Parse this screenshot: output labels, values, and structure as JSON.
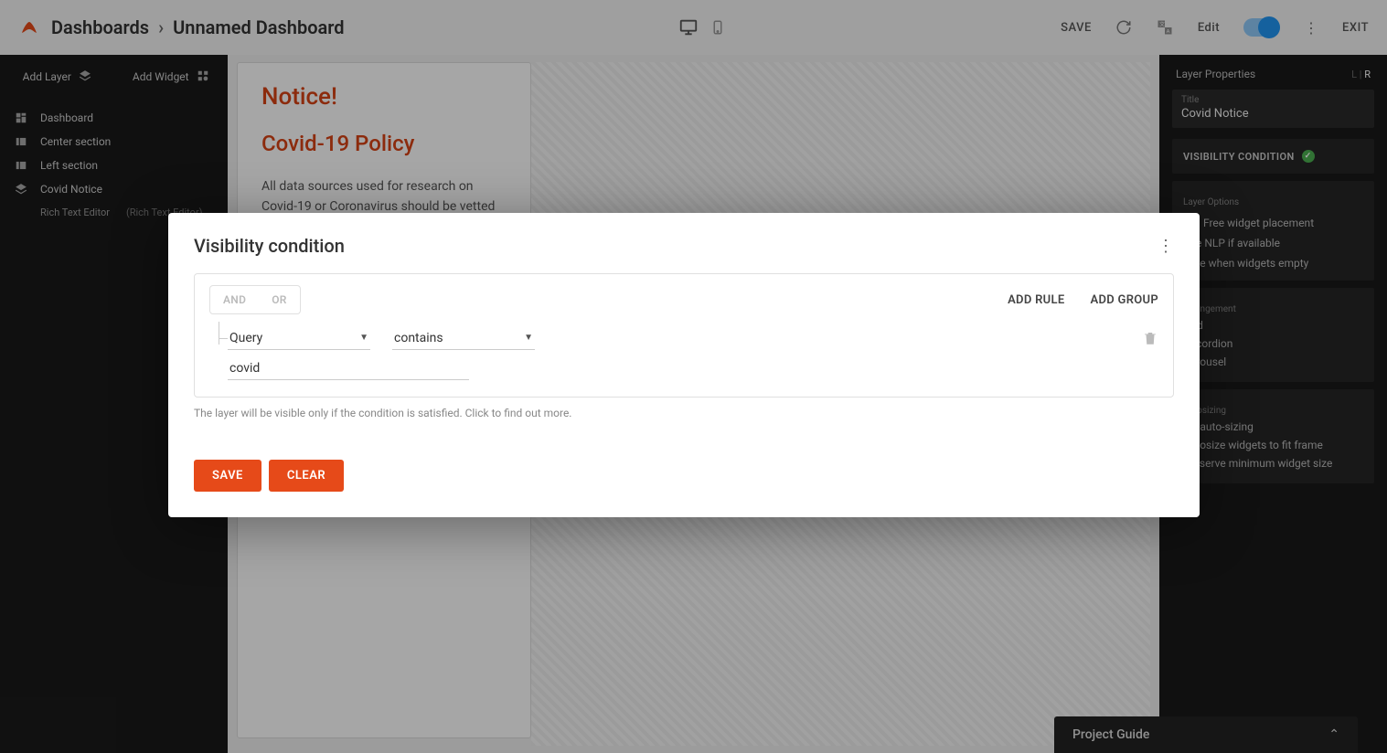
{
  "header": {
    "breadcrumb_root": "Dashboards",
    "breadcrumb_current": "Unnamed Dashboard",
    "save": "SAVE",
    "edit": "Edit",
    "exit": "EXIT"
  },
  "leftpanel": {
    "add_layer": "Add Layer",
    "add_widget": "Add Widget",
    "items": [
      {
        "label": "Dashboard"
      },
      {
        "label": "Center section"
      },
      {
        "label": "Left section"
      },
      {
        "label": "Covid Notice"
      }
    ],
    "subitem": {
      "primary": "Rich Text Editor",
      "secondary": "(Rich Text Editor)"
    }
  },
  "notice": {
    "title": "Notice!",
    "subtitle": "Covid-19 Policy",
    "body": "All data sources used for research on Covid-19 or Coronavirus should be vetted by the internal QMS group."
  },
  "rightpanel": {
    "header": "Layer Properties",
    "lr_l": "L",
    "lr_sep": " | ",
    "lr_r": "R",
    "title_label": "Title",
    "title_value": "Covid Notice",
    "visibility_label": "VISIBILITY CONDITION",
    "layer_options_label": "Layer Options",
    "layer_options": [
      "Free widget placement",
      "Use NLP if available",
      "Hide when widgets empty"
    ],
    "arrangement_label": "Arrangement",
    "arrangement": [
      "Grid",
      "Accordion",
      "Carousel"
    ],
    "autosizing_label": "Autosizing",
    "autosizing": [
      "No auto-sizing",
      "Autosize widgets to fit frame",
      "Preserve minimum widget size"
    ]
  },
  "project_guide": "Project Guide",
  "modal": {
    "title": "Visibility condition",
    "and": "AND",
    "or": "OR",
    "add_rule": "ADD RULE",
    "add_group": "ADD GROUP",
    "field_select": "Query",
    "op_select": "contains",
    "value_input": "covid",
    "hint": "The layer will be visible only if the condition is satisfied. Click to find out more.",
    "save": "SAVE",
    "clear": "CLEAR"
  }
}
